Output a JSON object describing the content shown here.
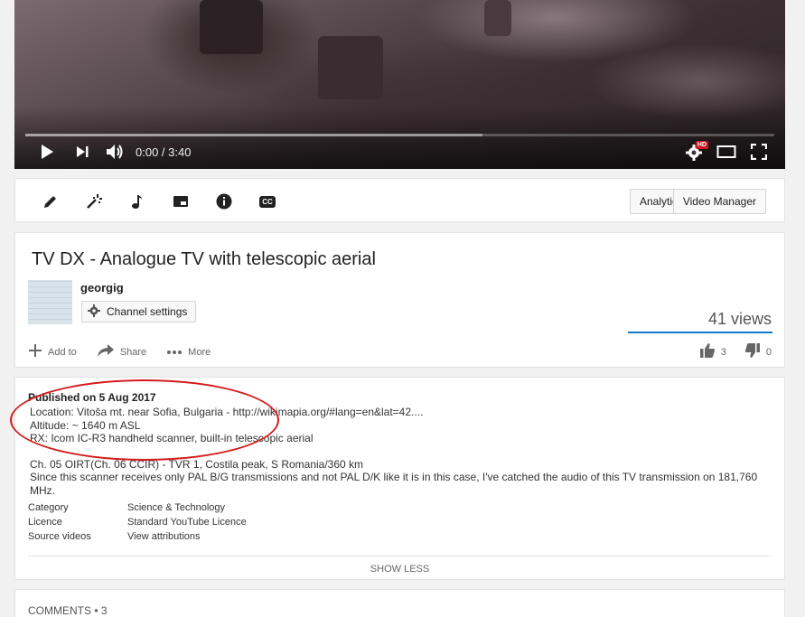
{
  "player": {
    "time": "0:00 / 3:40",
    "progress_loaded": 0.61,
    "hd_badge": "HD",
    "icons": [
      "play-icon",
      "next-icon",
      "volume-icon",
      "settings-icon",
      "theater-mode-icon",
      "fullscreen-icon"
    ]
  },
  "toolbar": {
    "icons": [
      "pencil-icon",
      "magic-wand-icon",
      "music-note-icon",
      "card-icon",
      "info-icon",
      "captions-icon"
    ],
    "captions_label": "CC",
    "analytics_label": "Analytics",
    "video_manager_label": "Video Manager"
  },
  "video": {
    "title": "TV DX - Analogue TV with telescopic aerial",
    "channel": "georgig",
    "channel_settings_label": "Channel settings",
    "views": "41 views",
    "add_to_label": "Add to",
    "share_label": "Share",
    "more_label": "More",
    "likes": "3",
    "dislikes": "0"
  },
  "description": {
    "published": "Published on 5 Aug 2017",
    "lines": [
      "Location: Vitoša mt. near Sofia, Bulgaria - http://wikimapia.org/#lang=en&lat=42....",
      "Altitude: ~ 1640 m ASL",
      "RX: Icom IC-R3 handheld scanner, built-in telescopic aerial",
      "",
      "Ch. 05 OIRT(Ch. 06 CCIR) - TVR 1, Costila peak, S Romania/360 km",
      "Since this scanner receives only PAL B/G transmissions and not PAL D/K like it is in this case, I've catched the audio of this TV transmission on 181,760 MHz."
    ],
    "meta": [
      {
        "label": "Category",
        "value": "Science & Technology"
      },
      {
        "label": "Licence",
        "value": "Standard YouTube Licence"
      },
      {
        "label": "Source videos",
        "value": "View attributions"
      }
    ],
    "show_less_label": "SHOW LESS"
  },
  "comments": {
    "title": "COMMENTS • 3"
  },
  "colors": {
    "accent_blue": "#167ac6",
    "annotation_red": "#d51b1b",
    "hd_red": "#cc181e"
  }
}
